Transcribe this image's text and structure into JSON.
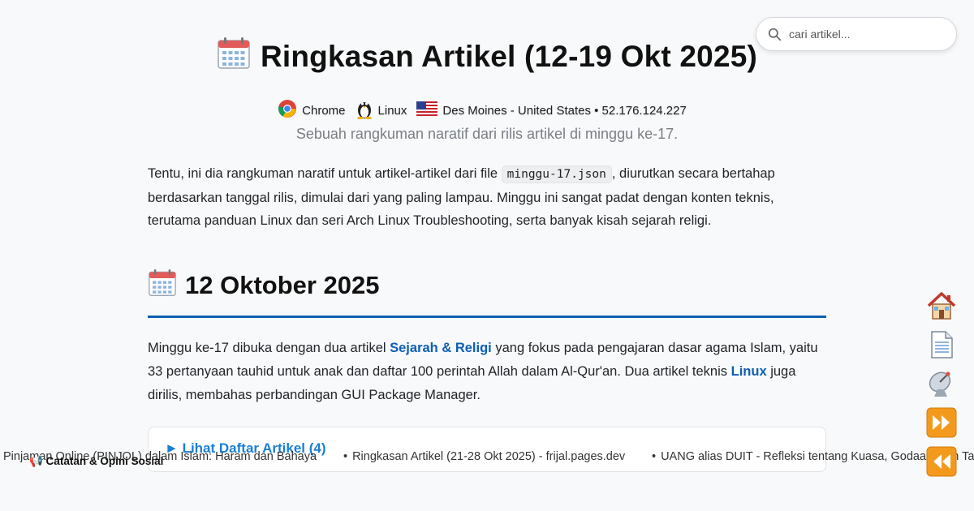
{
  "search": {
    "placeholder": "cari artikel..."
  },
  "header": {
    "title": "Ringkasan Artikel (12-19 Okt 2025)",
    "title_icon": "calendar-icon",
    "meta": {
      "browser": "Chrome",
      "os": "Linux",
      "location": "Des Moines - United States • 52.176.124.227"
    },
    "subtitle": "Sebuah rangkuman naratif dari rilis artikel di minggu ke-17."
  },
  "intro": {
    "before_code": "Tentu, ini dia rangkuman naratif untuk artikel-artikel dari file ",
    "code": "minggu-17.json",
    "after_code": ", diurutkan secara bertahap berdasarkan tanggal rilis, dimulai dari yang paling lampau. Minggu ini sangat padat dengan konten teknis, terutama panduan Linux dan seri Arch Linux Troubleshooting, serta banyak kisah sejarah religi."
  },
  "section": {
    "heading": "12 Oktober 2025",
    "p_part1": "Minggu ke-17 dibuka dengan dua artikel ",
    "link1": "Sejarah & Religi",
    "p_part2": " yang fokus pada pengajaran dasar agama Islam, yaitu 33 pertanyaan tauhid untuk anak dan daftar 100 perintah Allah dalam Al-Qur'an. Dua artikel teknis ",
    "link2": "Linux",
    "p_part3": " juga dirilis, membahas perbandingan GUI Package Manager.",
    "details_summary": "Lihat Daftar Artikel (4)"
  },
  "ticker": {
    "items": [
      "Pinjaman Online (PINJOL) dalam Islam: Haram dan Bahaya",
      "Ringkasan Artikel (21-28 Okt 2025) - frijal.pages.dev",
      "UANG alias DUIT - Refleksi tentang Kuasa, Godaan, dan Tan"
    ],
    "badge": "📢 Catatan & Opini Sosial"
  },
  "sidenav": [
    "home-icon",
    "document-icon",
    "satellite-icon",
    "fast-forward-icon",
    "rewind-icon"
  ],
  "colors": {
    "accent": "#0d5fb2",
    "link": "#1a7fd6",
    "nav_orange": "#f39a1d"
  }
}
